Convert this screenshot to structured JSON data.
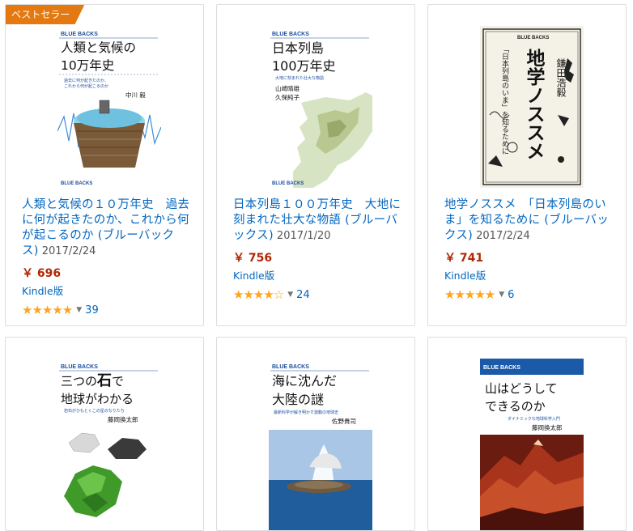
{
  "badge_label": "ベストセラー",
  "products": [
    {
      "title": "人類と気候の１０万年史　過去に何が起きたのか、これから何が起こるのか (ブルーバックス)",
      "date": "2017/2/24",
      "price": "￥ 696",
      "format": "Kindle版",
      "stars": 5,
      "stars_text": "★★★★★",
      "review_count": "39",
      "cover": {
        "series": "BLUE BACKS",
        "title_line1": "人類と気候の",
        "title_line2": "10万年史",
        "subtitle_line1": "過去に何が起きたのか、",
        "subtitle_line2": "これから何が起こるのか",
        "author": "中川 毅",
        "spine": "BLUE BACKS"
      }
    },
    {
      "title": "日本列島１００万年史　大地に刻まれた壮大な物語 (ブルーバックス)",
      "date": "2017/1/20",
      "price": "￥ 756",
      "format": "Kindle版",
      "stars": 3.5,
      "stars_text": "★★★★☆",
      "review_count": "24",
      "cover": {
        "series": "BLUE BACKS",
        "title_line1": "日本列島",
        "title_line2": "100万年史",
        "subtitle_line1": "大地に刻まれた壮大な物語",
        "author1": "山崎晴雄",
        "author2": "久保純子",
        "spine": "BLUE BACKS"
      }
    },
    {
      "title": "地学ノススメ　「日本列島のいま」を知るために (ブルーバックス)",
      "date": "2017/2/24",
      "price": "￥ 741",
      "format": "Kindle版",
      "stars": 4.5,
      "stars_text": "★★★★★",
      "review_count": "6",
      "cover": {
        "series": "BLUE BACKS",
        "title": "地学ノススメ",
        "subtitle": "「日本列島のいま」を知るために",
        "author": "鎌田浩毅"
      }
    },
    {
      "cover": {
        "series": "BLUE BACKS",
        "title_line1a": "三つの",
        "title_line1b": "石",
        "title_line1c": "で",
        "title_line2": "地球がわかる",
        "subtitle_line1": "岩石がひもとくこの星のなりたち",
        "author": "藤岡換太郎"
      }
    },
    {
      "cover": {
        "series": "BLUE BACKS",
        "title_line1": "海に沈んだ",
        "title_line2": "大陸の謎",
        "subtitle_line1": "最新科学が解き明かす激動の地球史",
        "author": "佐野貴司"
      }
    },
    {
      "cover": {
        "series": "BLUE BACKS",
        "title_line1": "山はどうして",
        "title_line2": "できるのか",
        "subtitle_line1": "ダイナミックな地球科学入門",
        "author": "藤岡換太郎"
      }
    }
  ],
  "colors": {
    "link": "#0066c0",
    "price": "#b12704",
    "star": "#ffa41c",
    "badge": "#e47911",
    "card_border": "#dddddd"
  },
  "icons": [
    "star-icon",
    "caret-down-icon"
  ]
}
